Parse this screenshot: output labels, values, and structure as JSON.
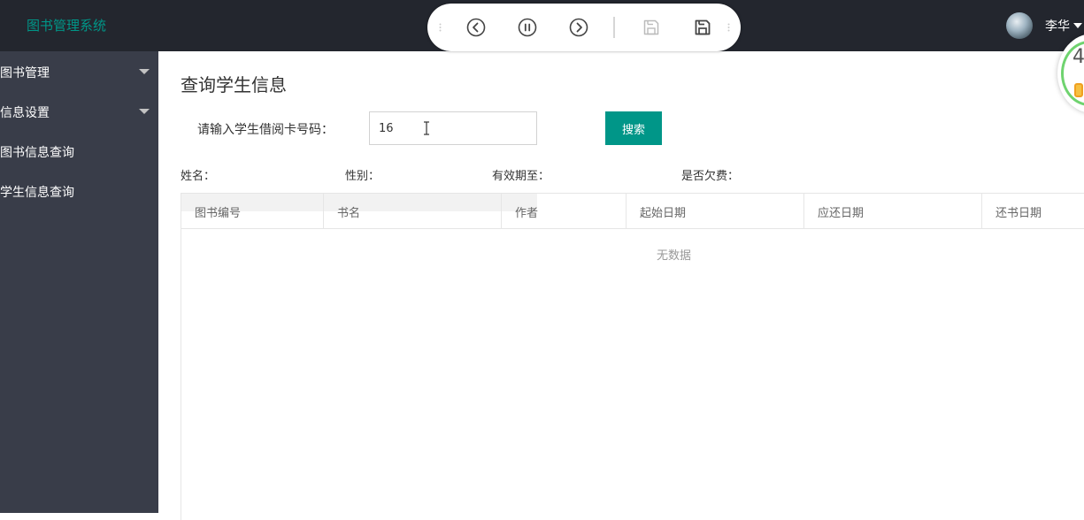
{
  "app": {
    "title": "图书管理系统"
  },
  "toolbar": {
    "buttons": [
      {
        "name": "previous",
        "icon": "chevron-left-circle-icon"
      },
      {
        "name": "pause",
        "icon": "pause-circle-icon"
      },
      {
        "name": "next",
        "icon": "chevron-right-circle-icon"
      },
      {
        "name": "save",
        "icon": "floppy-disk-icon"
      },
      {
        "name": "save-as",
        "icon": "floppy-disk-bold-icon"
      }
    ]
  },
  "user": {
    "name": "李华",
    "avatar_icon": "avatar-icon"
  },
  "gauge": {
    "text": "4"
  },
  "sidebar": {
    "items": [
      {
        "label": "图书管理",
        "expandable": true
      },
      {
        "label": "信息设置",
        "expandable": true
      },
      {
        "label": "图书信息查询",
        "expandable": false
      },
      {
        "label": "学生信息查询",
        "expandable": false
      }
    ]
  },
  "main": {
    "title": "查询学生信息",
    "search": {
      "label": "请输入学生借阅卡号码：",
      "value": "16",
      "button_label": "搜索"
    },
    "info": {
      "name_label": "姓名：",
      "gender_label": "性别：",
      "valid_until_label": "有效期至：",
      "overdue_label": "是否欠费："
    },
    "table": {
      "columns": [
        "图书编号",
        "书名",
        "作者",
        "起始日期",
        "应还日期",
        "还书日期"
      ],
      "empty_text": "无数据"
    }
  },
  "colors": {
    "header_bg": "#23262e",
    "sidebar_bg": "#393d49",
    "accent": "#009688"
  }
}
